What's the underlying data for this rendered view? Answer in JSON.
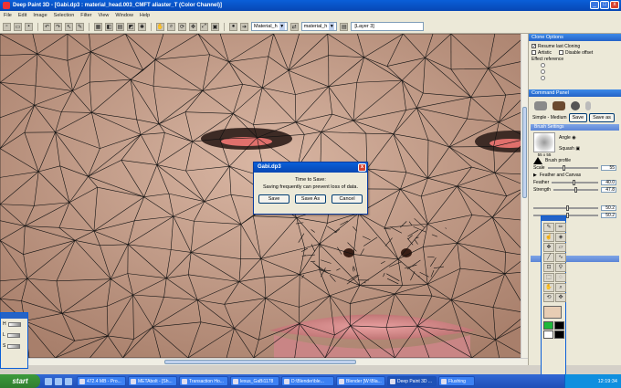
{
  "window": {
    "title": "Deep Paint 3D - [Gabi.dp3 : material_head.003_CMFT aliaster_T (Color Channel)]",
    "min": "_",
    "max": "□",
    "close": "x"
  },
  "menu": [
    "File",
    "Edit",
    "Image",
    "Selection",
    "Filter",
    "View",
    "Window",
    "Help"
  ],
  "toolbar": {
    "material_select": "Material_h",
    "material_select2": "material_h",
    "layer": "[Layer 3]"
  },
  "dialog": {
    "title": "Gabi.dp3",
    "message_line1": "Time to Save:",
    "message_line2": "Saving frequently can prevent loss of data.",
    "save": "Save",
    "save_as": "Save As",
    "cancel": "Cancel",
    "close": "x"
  },
  "clone_options": {
    "header": "Clone Options",
    "resume": "Resume last Cloning",
    "artistic": "Artistic",
    "disable_offset": "Disable offset",
    "effect_reference": "Effect reference"
  },
  "command_panel": {
    "header": "Command Panel",
    "mode": "Simple - Medium",
    "save": "Save",
    "save_as": "Save as",
    "brush_settings": "Brush Settings",
    "brush_size": "55 x 55",
    "angle": "Angle",
    "squash": "Squash",
    "brush_profile": "Brush profile",
    "scale_label": "Scale",
    "scale_value": "55",
    "feather_canvas": "Feather and Canvas",
    "feather_label": "Feather",
    "feather_value": "40.0",
    "strength_label": "Strength",
    "strength_value": "47.8",
    "val3": "50.2",
    "val4": "50.2"
  },
  "hls": {
    "h": "H",
    "l": "L",
    "s": "S"
  },
  "taskbar": {
    "start": "start",
    "tasks": [
      "472.4 MB - Pro...",
      "METAbolt - [Sh...",
      "Transaction Ho...",
      "lexus_GaBi1178",
      "D:\\Blender\\ble...",
      "Blender [W:\\Bla...",
      "Deep Paint 3D ...",
      "Flushing"
    ],
    "clock": "12:19:34"
  },
  "colors": {
    "accent": "#0a5fd8",
    "skin": "#c9a592",
    "lips": "#d98c8c"
  }
}
